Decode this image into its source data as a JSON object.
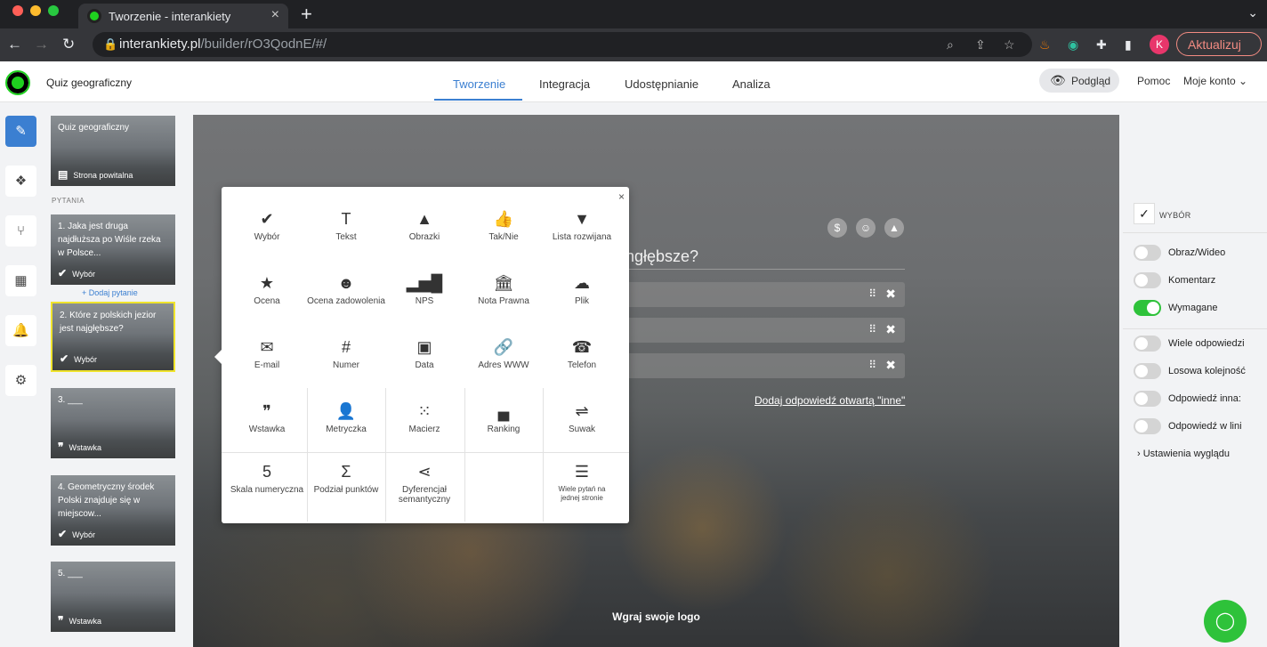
{
  "browser": {
    "tab_title": "Tworzenie - interankiety",
    "url_host": "interankiety.pl",
    "url_path": "/builder/rO3QodnE/#/",
    "update_label": "Aktualizuj",
    "avatar_letter": "K"
  },
  "header": {
    "quiz_name": "Quiz geograficzny",
    "tabs": [
      "Tworzenie",
      "Integracja",
      "Udostępnianie",
      "Analiza"
    ],
    "preview_label": "Podgląd",
    "help_label": "Pomoc",
    "account_label": "Moje konto"
  },
  "sidebar": {
    "welcome": {
      "title": "Quiz geograficzny",
      "type": "Strona powitalna"
    },
    "section_label": "PYTANIA",
    "add_question": "+ Dodaj pytanie",
    "questions": [
      {
        "title": "1. Jaka jest druga najdłuższa po Wiśle rzeka w Polsce...",
        "type": "Wybór"
      },
      {
        "title": "2. Które z polskich jezior jest najgłębsze?",
        "type": "Wybór"
      },
      {
        "title": "3. ___",
        "type": "Wstawka"
      },
      {
        "title": "4. Geometryczny środek Polski znajduje się w miejscow...",
        "type": "Wybór"
      },
      {
        "title": "5. ___",
        "type": "Wstawka"
      }
    ]
  },
  "canvas": {
    "question_fragment": "ngłębsze?",
    "add_other": "Dodaj odpowiedź otwartą \"inne\"",
    "upload_logo": "Wgraj swoje logo"
  },
  "popup": {
    "close": "×",
    "types": [
      {
        "label": "Wybór",
        "icon": "✔"
      },
      {
        "label": "Tekst",
        "icon": "T"
      },
      {
        "label": "Obrazki",
        "icon": "▲"
      },
      {
        "label": "Tak/Nie",
        "icon": "👍"
      },
      {
        "label": "Lista rozwijana",
        "icon": "▼"
      },
      {
        "label": "Ocena",
        "icon": "★"
      },
      {
        "label": "Ocena zadowolenia",
        "icon": "☻"
      },
      {
        "label": "NPS",
        "icon": "▂▅█"
      },
      {
        "label": "Nota Prawna",
        "icon": "🏛"
      },
      {
        "label": "Plik",
        "icon": "☁"
      },
      {
        "label": "E-mail",
        "icon": "✉"
      },
      {
        "label": "Numer",
        "icon": "#"
      },
      {
        "label": "Data",
        "icon": "▣"
      },
      {
        "label": "Adres WWW",
        "icon": "🔗"
      },
      {
        "label": "Telefon",
        "icon": "☎"
      },
      {
        "label": "Wstawka",
        "icon": "❞"
      },
      {
        "label": "Metryczka",
        "icon": "👤"
      },
      {
        "label": "Macierz",
        "icon": "⁙"
      },
      {
        "label": "Ranking",
        "icon": "▄"
      },
      {
        "label": "Suwak",
        "icon": "⇌"
      },
      {
        "label": "Skala numeryczna",
        "icon": "5"
      },
      {
        "label": "Podział punktów",
        "icon": "Σ"
      },
      {
        "label": "Dyferencjał semantyczny",
        "icon": "⋖"
      },
      {
        "label": "",
        "icon": ""
      },
      {
        "label": "Wiele pytań na jednej stronie",
        "icon": "☰"
      }
    ]
  },
  "right_panel": {
    "type_label": "WYBÓR",
    "toggles": [
      {
        "label": "Obraz/Wideo",
        "on": false
      },
      {
        "label": "Komentarz",
        "on": false
      },
      {
        "label": "Wymagane",
        "on": true
      },
      {
        "label": "Wiele odpowiedzi",
        "on": false
      },
      {
        "label": "Losowa kolejność",
        "on": false
      },
      {
        "label": "Odpowiedź inna:",
        "on": false
      },
      {
        "label": "Odpowiedź w lini",
        "on": false
      }
    ],
    "look_settings": "Ustawienia wyglądu"
  }
}
